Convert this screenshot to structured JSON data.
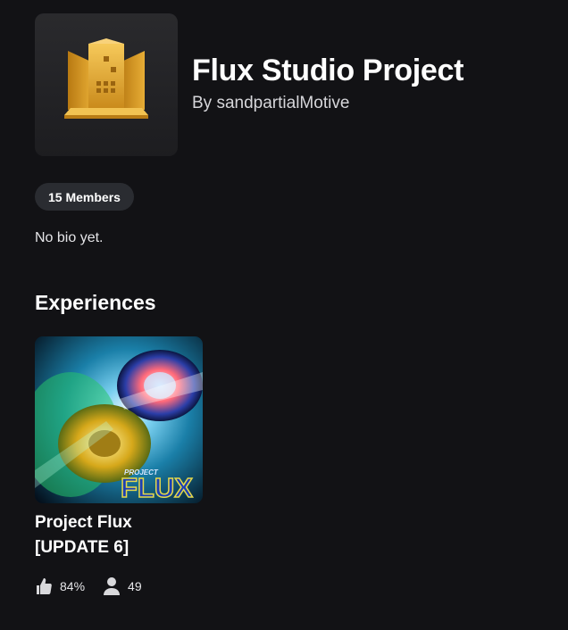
{
  "group": {
    "name": "Flux Studio Project",
    "owner_prefix": "By",
    "owner_name": "sandpartialMotive",
    "members_badge": "15 Members",
    "bio": "No bio yet."
  },
  "experiences": {
    "heading": "Experiences",
    "items": [
      {
        "title": "Project Flux [UPDATE 6]",
        "thumbnail_text_top": "PROJECT",
        "thumbnail_text_main": "FLUX",
        "like_ratio": "84%",
        "player_count": "49"
      }
    ]
  },
  "icons": {
    "group_icon": "gold-building-icon",
    "like": "thumbs-up-icon",
    "players": "person-icon"
  },
  "colors": {
    "background": "#121215",
    "badge_background": "#2a2c31",
    "gold": "#e2a52a"
  }
}
